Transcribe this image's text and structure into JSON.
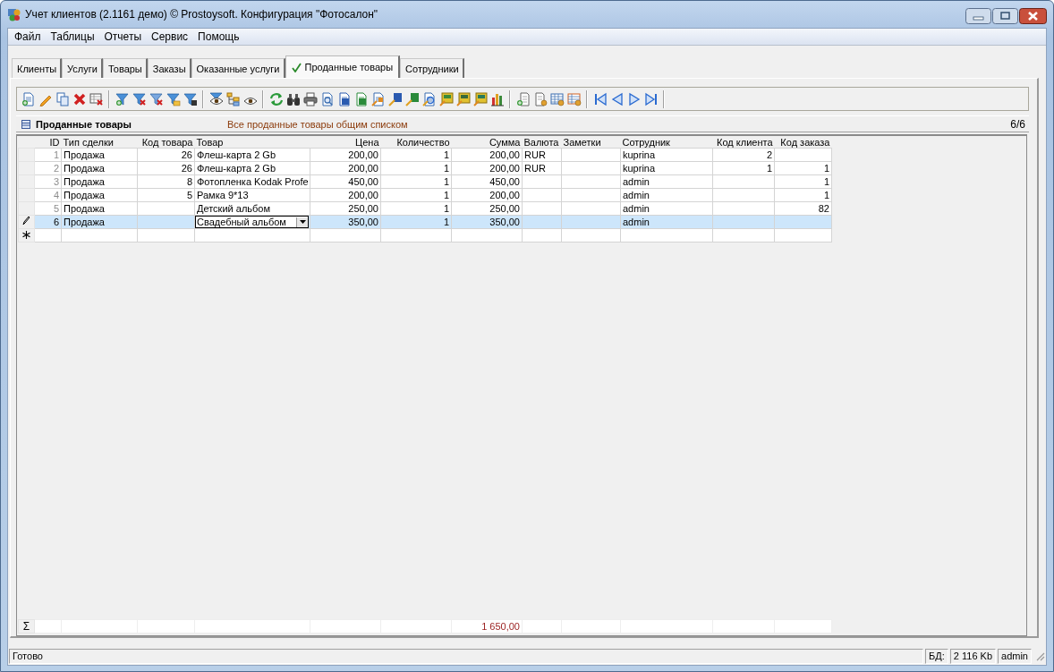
{
  "window": {
    "title": "Учет клиентов (2.1161 демо) © Prostoysoft. Конфигурация \"Фотосалон\""
  },
  "menu": [
    "Файл",
    "Таблицы",
    "Отчеты",
    "Сервис",
    "Помощь"
  ],
  "tabs": [
    {
      "label": "Клиенты",
      "selected": false
    },
    {
      "label": "Услуги",
      "selected": false
    },
    {
      "label": "Товары",
      "selected": false
    },
    {
      "label": "Заказы",
      "selected": false
    },
    {
      "label": "Оказанные услуги",
      "selected": false
    },
    {
      "label": "Проданные товары",
      "selected": true
    },
    {
      "label": "Сотрудники",
      "selected": false
    }
  ],
  "panel": {
    "title": "Проданные товары",
    "description": "Все проданные товары общим списком",
    "counter": "6/6"
  },
  "grid": {
    "columns": [
      {
        "label": "ID",
        "kind": "id"
      },
      {
        "label": "Тип сделки",
        "kind": "text"
      },
      {
        "label": "Код товара",
        "kind": "number"
      },
      {
        "label": "Товар",
        "kind": "lookup"
      },
      {
        "label": "Цена",
        "kind": "number"
      },
      {
        "label": "Количество",
        "kind": "number"
      },
      {
        "label": "Сумма",
        "kind": "number",
        "total": "1 650,00"
      },
      {
        "label": "Валюта",
        "kind": "text"
      },
      {
        "label": "Заметки",
        "kind": "text"
      },
      {
        "label": "Сотрудник",
        "kind": "text"
      },
      {
        "label": "Код клиента",
        "kind": "number"
      },
      {
        "label": "Код заказа",
        "kind": "number"
      }
    ],
    "rows": [
      {
        "selected": false,
        "editing": false,
        "cells": [
          "1",
          "Продажа",
          "26",
          "Флеш-карта 2 Gb",
          "200,00",
          "1",
          "200,00",
          "RUR",
          "",
          "kuprina",
          "2",
          ""
        ]
      },
      {
        "selected": false,
        "editing": false,
        "cells": [
          "2",
          "Продажа",
          "26",
          "Флеш-карта 2 Gb",
          "200,00",
          "1",
          "200,00",
          "RUR",
          "",
          "kuprina",
          "1",
          "1"
        ]
      },
      {
        "selected": false,
        "editing": false,
        "cells": [
          "3",
          "Продажа",
          "8",
          "Фотопленка Kodak Profe",
          "450,00",
          "1",
          "450,00",
          "",
          "",
          "admin",
          "",
          "1"
        ]
      },
      {
        "selected": false,
        "editing": false,
        "cells": [
          "4",
          "Продажа",
          "5",
          "Рамка 9*13",
          "200,00",
          "1",
          "200,00",
          "",
          "",
          "admin",
          "",
          "1"
        ]
      },
      {
        "selected": false,
        "editing": false,
        "cells": [
          "5",
          "Продажа",
          "",
          "Детский альбом",
          "250,00",
          "1",
          "250,00",
          "",
          "",
          "admin",
          "",
          "82"
        ]
      },
      {
        "selected": true,
        "editing": true,
        "cells": [
          "6",
          "Продажа",
          "",
          "Свадебный альбом",
          "350,00",
          "1",
          "350,00",
          "",
          "",
          "admin",
          "",
          ""
        ]
      }
    ],
    "new_row": true,
    "totals_mark": "Σ"
  },
  "status_bar": {
    "message": "Готово",
    "db_label": "БД:",
    "db_size": "2 116 Kb",
    "user": "admin"
  }
}
